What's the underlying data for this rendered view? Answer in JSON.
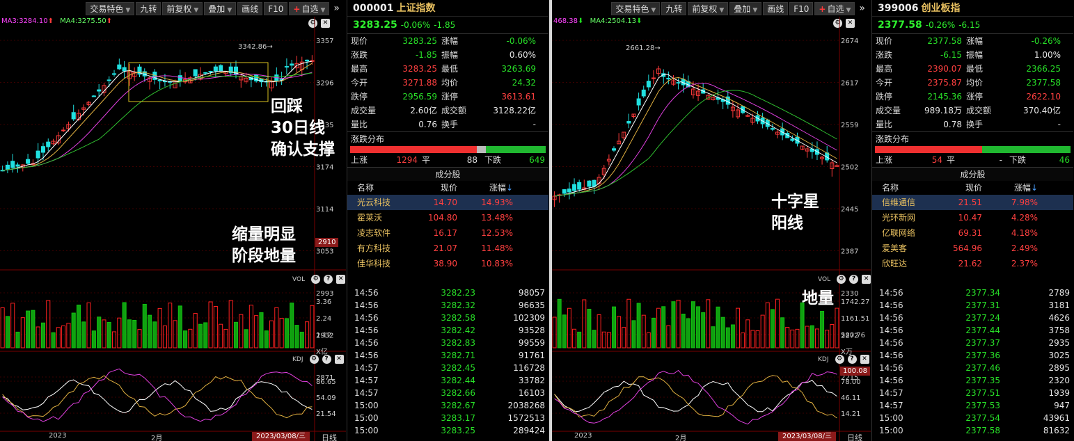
{
  "toolbar": {
    "items": [
      "交易特色",
      "九转",
      "前复权",
      "叠加",
      "画线",
      "F10",
      "自选"
    ],
    "more": "»"
  },
  "left": {
    "ma3": "MA3:3284.10",
    "ma4": "MA4:3275.50",
    "price_axis": [
      "3357",
      "3296",
      "3235",
      "3174",
      "3114",
      "3053",
      "2993",
      "2932",
      "2871"
    ],
    "price_marker": "2910",
    "high_label": "3342.86",
    "vol_label": "VOL",
    "vol_axis": [
      "3.36",
      "2.24",
      "1.12",
      "X亿"
    ],
    "kdj_label": "KDJ",
    "kdj_axis": [
      "86.65",
      "54.09",
      "21.54"
    ],
    "x_labels": [
      "2023",
      "2月"
    ],
    "date_box": "2023/03/08/三",
    "period": "日线",
    "annotations": {
      "pullback": [
        "回踩",
        "30日线",
        "确认支撑"
      ],
      "volume": [
        "缩量明显",
        "阶段地量"
      ]
    },
    "side": {
      "code": "000001",
      "name": "上证指数",
      "price": "3283.25",
      "pct": "-0.06%",
      "chg": "-1.85",
      "rows": [
        [
          "现价",
          "3283.25",
          "涨幅",
          "-0.06%"
        ],
        [
          "涨跌",
          "-1.85",
          "振幅",
          "0.60%"
        ],
        [
          "最高",
          "3283.25",
          "最低",
          "3263.69"
        ],
        [
          "今开",
          "3271.88",
          "均价",
          "24.32"
        ],
        [
          "跌停",
          "2956.59",
          "涨停",
          "3613.61"
        ],
        [
          "成交量",
          "2.60亿",
          "成交额",
          "3128.22亿"
        ],
        [
          "量比",
          "0.76",
          "换手",
          "-"
        ]
      ],
      "dist_title": "涨跌分布",
      "up_label": "上涨",
      "up": "1294",
      "flat_label": "平",
      "flat": "88",
      "down_label": "下跌",
      "down": "649",
      "cfg_title": "成分股",
      "cfg_head": [
        "名称",
        "现价",
        "涨幅"
      ],
      "cfg": [
        [
          "光云科技",
          "14.70",
          "14.93%"
        ],
        [
          "霍莱沃",
          "104.80",
          "13.48%"
        ],
        [
          "凌志软件",
          "16.17",
          "12.53%"
        ],
        [
          "有方科技",
          "21.07",
          "11.48%"
        ],
        [
          "佳华科技",
          "38.90",
          "10.83%"
        ]
      ],
      "trades": [
        [
          "14:56",
          "3282.23",
          "98057"
        ],
        [
          "14:56",
          "3282.32",
          "96635"
        ],
        [
          "14:56",
          "3282.58",
          "102309"
        ],
        [
          "14:56",
          "3282.42",
          "93528"
        ],
        [
          "14:56",
          "3282.83",
          "99559"
        ],
        [
          "14:56",
          "3282.71",
          "91761"
        ],
        [
          "14:57",
          "3282.45",
          "116728"
        ],
        [
          "14:57",
          "3282.44",
          "33782"
        ],
        [
          "14:57",
          "3282.66",
          "16103"
        ],
        [
          "15:00",
          "3282.67",
          "2038268"
        ],
        [
          "15:00",
          "3283.17",
          "1572513"
        ],
        [
          "15:00",
          "3283.25",
          "289424"
        ]
      ]
    }
  },
  "right": {
    "ma_prefix": "468.38",
    "ma4": "MA4:2504.13",
    "price_axis": [
      "2674",
      "2617",
      "2559",
      "2502",
      "2445",
      "2387",
      "2330",
      "2272",
      "2215"
    ],
    "high_label": "2661.28",
    "vol_label": "VOL",
    "vol_axis": [
      "1742.27",
      "1161.51",
      "580.76",
      "X万"
    ],
    "kdj_label": "KDJ",
    "kdj_axis": [
      "78.00",
      "46.11",
      "14.21"
    ],
    "kdj_marker": "100.08",
    "x_labels": [
      "2023",
      "2月"
    ],
    "date_box": "2023/03/08/三",
    "period": "日线",
    "annotations": {
      "doji": [
        "十字星",
        "阳线"
      ],
      "volume": [
        "地量"
      ]
    },
    "side": {
      "code": "399006",
      "name": "创业板指",
      "price": "2377.58",
      "pct": "-0.26%",
      "chg": "-6.15",
      "rows": [
        [
          "现价",
          "2377.58",
          "涨幅",
          "-0.26%"
        ],
        [
          "涨跌",
          "-6.15",
          "振幅",
          "1.00%"
        ],
        [
          "最高",
          "2390.07",
          "最低",
          "2366.25"
        ],
        [
          "今开",
          "2375.87",
          "均价",
          "2377.58"
        ],
        [
          "跌停",
          "2145.36",
          "涨停",
          "2622.10"
        ],
        [
          "成交量",
          "989.18万",
          "成交额",
          "370.40亿"
        ],
        [
          "量比",
          "0.78",
          "换手",
          "-"
        ]
      ],
      "dist_title": "涨跌分布",
      "up_label": "上涨",
      "up": "54",
      "flat_label": "平",
      "flat": "-",
      "down_label": "下跌",
      "down": "46",
      "cfg_title": "成分股",
      "cfg_head": [
        "名称",
        "现价",
        "涨幅"
      ],
      "cfg": [
        [
          "信维通信",
          "21.51",
          "7.98%"
        ],
        [
          "光环新网",
          "10.47",
          "4.28%"
        ],
        [
          "亿联网络",
          "69.31",
          "4.18%"
        ],
        [
          "爱美客",
          "564.96",
          "2.49%"
        ],
        [
          "欣旺达",
          "21.62",
          "2.37%"
        ]
      ],
      "trades": [
        [
          "14:56",
          "2377.34",
          "2789"
        ],
        [
          "14:56",
          "2377.31",
          "3181"
        ],
        [
          "14:56",
          "2377.24",
          "4626"
        ],
        [
          "14:56",
          "2377.44",
          "3758"
        ],
        [
          "14:56",
          "2377.37",
          "2935"
        ],
        [
          "14:56",
          "2377.36",
          "3025"
        ],
        [
          "14:56",
          "2377.46",
          "2895"
        ],
        [
          "14:56",
          "2377.35",
          "2320"
        ],
        [
          "14:57",
          "2377.51",
          "1939"
        ],
        [
          "14:57",
          "2377.53",
          "947"
        ],
        [
          "15:00",
          "2377.54",
          "43961"
        ],
        [
          "15:00",
          "2377.58",
          "81632"
        ]
      ]
    }
  }
}
